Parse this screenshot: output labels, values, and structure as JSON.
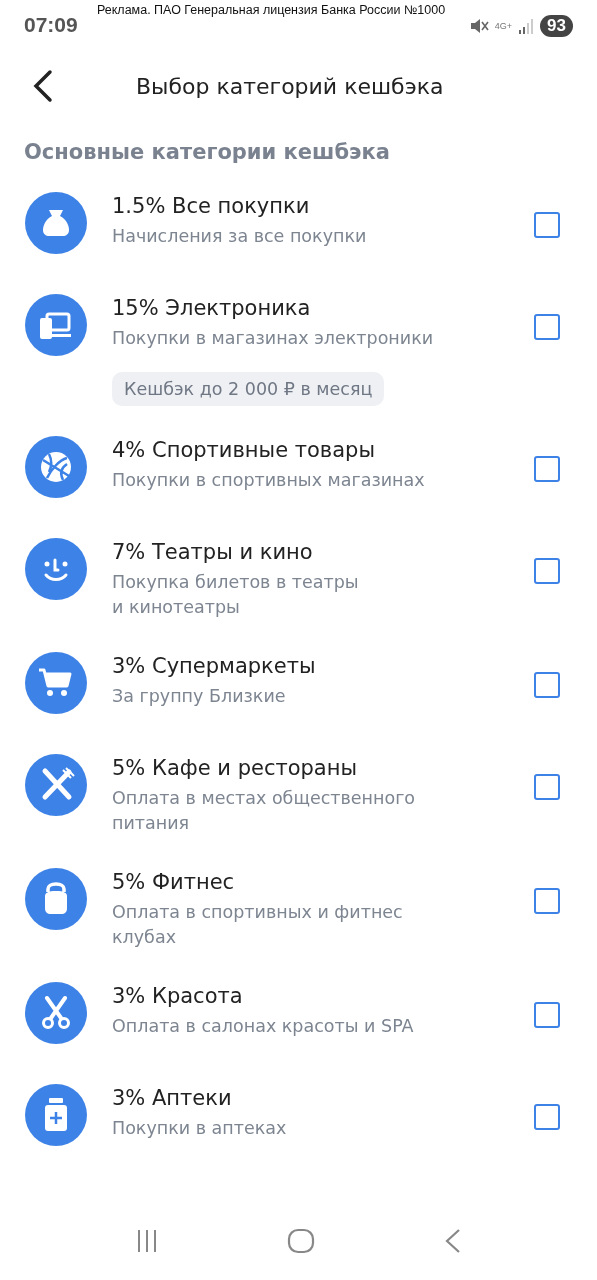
{
  "status_bar": {
    "time": "07:09",
    "ad_text": "Реклама. ПАО Генеральная лицензия Банка России №1000",
    "network": "4G+",
    "battery": "93"
  },
  "header": {
    "title": "Выбор категорий кешбэка"
  },
  "section": {
    "title": "Основные категории кешбэка"
  },
  "categories": [
    {
      "kind": "bag",
      "title": "1.5% Все покупки",
      "subtitle": "Начисления за все покупки",
      "checked": false
    },
    {
      "kind": "devices",
      "title": "15% Электроника",
      "subtitle": "Покупки в магазинах электроники",
      "checked": false,
      "badge": "Кешбэк до 2 000 ₽ в месяц"
    },
    {
      "kind": "ball",
      "title": "4% Спортивные товары",
      "subtitle": "Покупки в спортивных магазинах",
      "checked": false
    },
    {
      "kind": "smile",
      "title": "7% Театры и кино",
      "subtitle": "Покупка билетов в театры\nи кинотеатры",
      "checked": false
    },
    {
      "kind": "cart",
      "title": "3% Супермаркеты",
      "subtitle": "За группу Близкие",
      "checked": false
    },
    {
      "kind": "cutlery",
      "title": "5% Кафе и рестораны",
      "subtitle": "Оплата в местах общественного\nпитания",
      "checked": false
    },
    {
      "kind": "kettlebell",
      "title": "5% Фитнес",
      "subtitle": "Оплата в спортивных и фитнес\nклубах",
      "checked": false
    },
    {
      "kind": "scissors",
      "title": "3% Красота",
      "subtitle": "Оплата в салонах красоты и SPA",
      "checked": false
    },
    {
      "kind": "pill",
      "title": "3% Аптеки",
      "subtitle": "Покупки в аптеках",
      "checked": false
    }
  ]
}
